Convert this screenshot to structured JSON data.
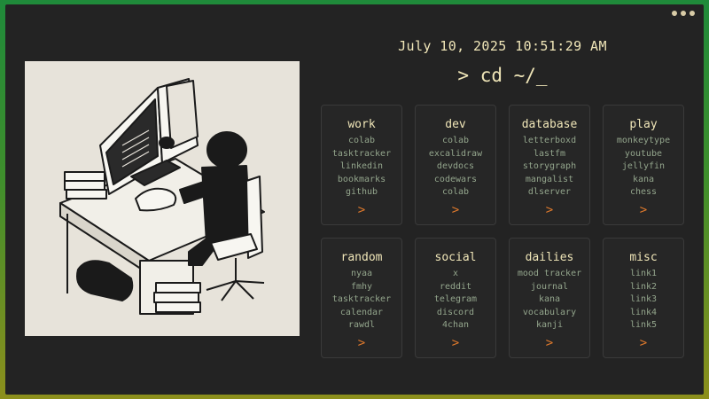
{
  "header": {
    "datetime": "July 10, 2025 10:51:29 AM",
    "prompt": "> cd ~/_"
  },
  "window": {
    "menu_icon": "more-dots-icon"
  },
  "illustration": {
    "subject": "person-at-computer-illustration"
  },
  "colors": {
    "background": "#232323",
    "accent": "#e07a2c",
    "title_text": "#f0e6b8",
    "link_text": "#93a58c"
  },
  "cards": [
    {
      "title": "work",
      "links": [
        "colab",
        "tasktracker",
        "linkedin",
        "bookmarks",
        "github"
      ],
      "arrow": ">"
    },
    {
      "title": "dev",
      "links": [
        "colab",
        "excalidraw",
        "devdocs",
        "codewars",
        "colab"
      ],
      "arrow": ">"
    },
    {
      "title": "database",
      "links": [
        "letterboxd",
        "lastfm",
        "storygraph",
        "mangalist",
        "dlserver"
      ],
      "arrow": ">"
    },
    {
      "title": "play",
      "links": [
        "monkeytype",
        "youtube",
        "jellyfin",
        "kana",
        "chess"
      ],
      "arrow": ">"
    },
    {
      "title": "random",
      "links": [
        "nyaa",
        "fmhy",
        "tasktracker",
        "calendar",
        "rawdl"
      ],
      "arrow": ">"
    },
    {
      "title": "social",
      "links": [
        "x",
        "reddit",
        "telegram",
        "discord",
        "4chan"
      ],
      "arrow": ">"
    },
    {
      "title": "dailies",
      "links": [
        "mood tracker",
        "journal",
        "kana",
        "vocabulary",
        "kanji"
      ],
      "arrow": ">"
    },
    {
      "title": "misc",
      "links": [
        "link1",
        "link2",
        "link3",
        "link4",
        "link5"
      ],
      "arrow": ">"
    }
  ]
}
